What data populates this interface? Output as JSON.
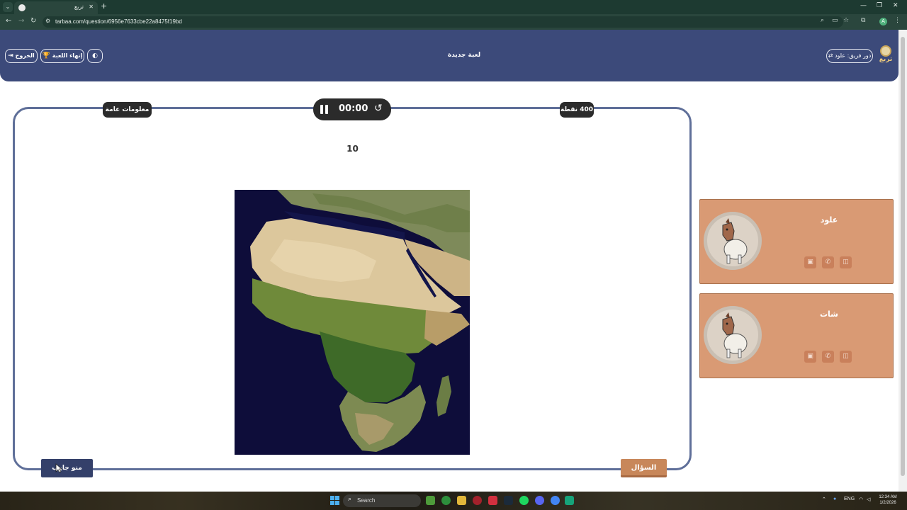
{
  "browser": {
    "tab_title": "تربع",
    "url": "tarbaa.com/question/6956e7633cbe22a8475f19bd",
    "profile_initial": "A"
  },
  "header": {
    "title": "لعبة جديدة",
    "team_turn_label": "دور فريق: علود",
    "logo_text": "تربع",
    "exit_label": "الخروج",
    "end_game_label": "إنهاء اللعبة"
  },
  "question": {
    "category": "معلومات عامة",
    "points": "400 نقطة",
    "timer": "00:00",
    "text": "10",
    "question_button": "السؤال",
    "answer_button": "منو جاوب"
  },
  "teams": [
    {
      "name": "علود"
    },
    {
      "name": "شات"
    }
  ],
  "taskbar": {
    "search_placeholder": "Search",
    "language": "ENG",
    "time": "12:34 AM",
    "date": "1/2/2026"
  },
  "colors": {
    "header_bg": "#3c4a7a",
    "board_border": "#5f6f99",
    "team_card_bg": "#d99a74",
    "question_button_bg": "#c8875a",
    "answer_button_bg": "#34406a",
    "pill_bg": "#2b2b2b"
  }
}
